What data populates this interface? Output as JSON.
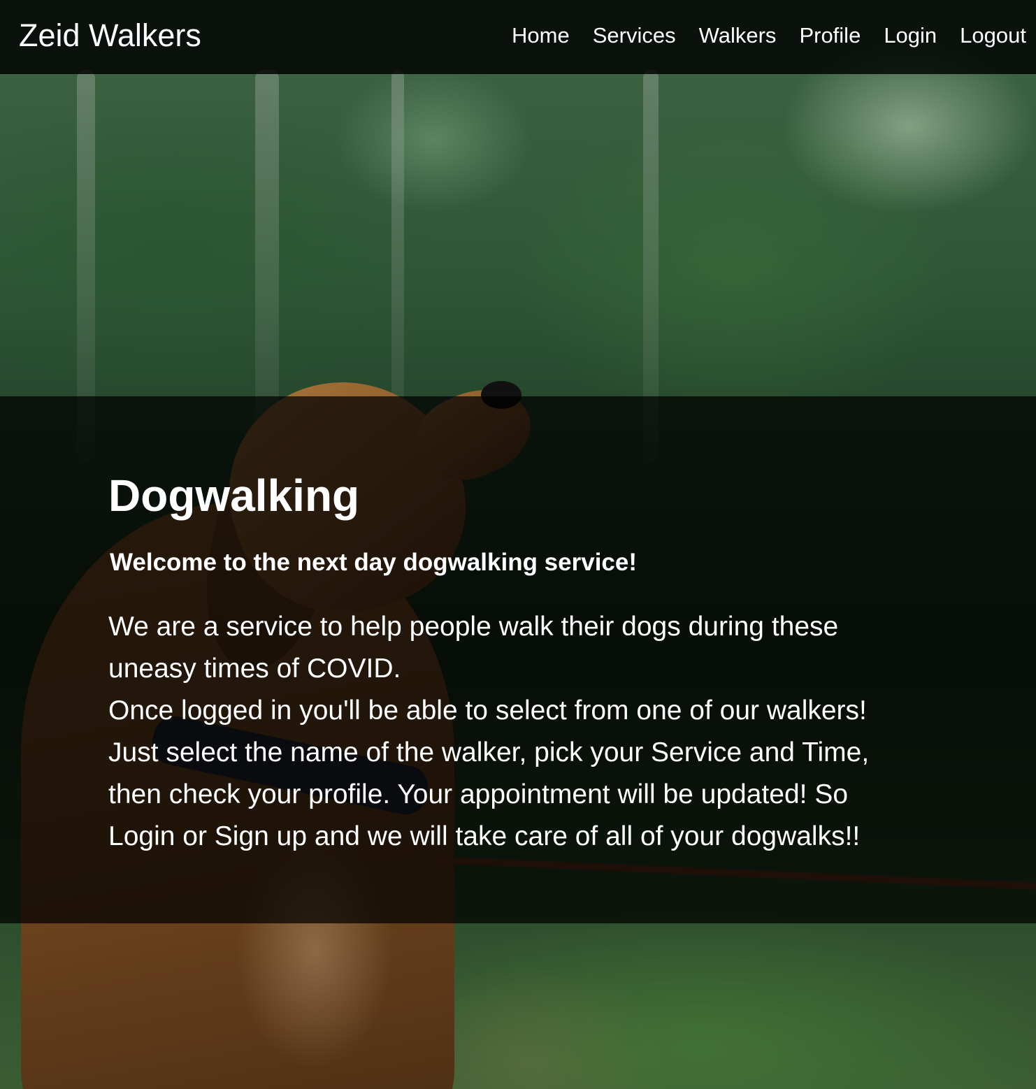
{
  "navbar": {
    "brand": "Zeid Walkers",
    "links": [
      {
        "label": "Home"
      },
      {
        "label": "Services"
      },
      {
        "label": "Walkers"
      },
      {
        "label": "Profile"
      },
      {
        "label": "Login"
      },
      {
        "label": "Logout"
      }
    ]
  },
  "hero": {
    "title": "Dogwalking",
    "subtitle": "Welcome to the next day dogwalking service!",
    "paragraph_lines": [
      "We are a service to help people walk their dogs during these",
      "uneasy times of COVID.",
      "Once logged in you'll be able to select from one of our walkers!",
      "Just select the name of the walker, pick your Service and Time,",
      "then check your profile. Your appointment will be updated! So",
      "Login or Sign up and we will take care of all of your dogwalks!!"
    ]
  },
  "colors": {
    "text": "#ffffff",
    "navbar_bg": "#000000",
    "overlay_bg": "#000000",
    "forest_green": "#2f5736",
    "dog_fur": "#8a5a2b"
  }
}
